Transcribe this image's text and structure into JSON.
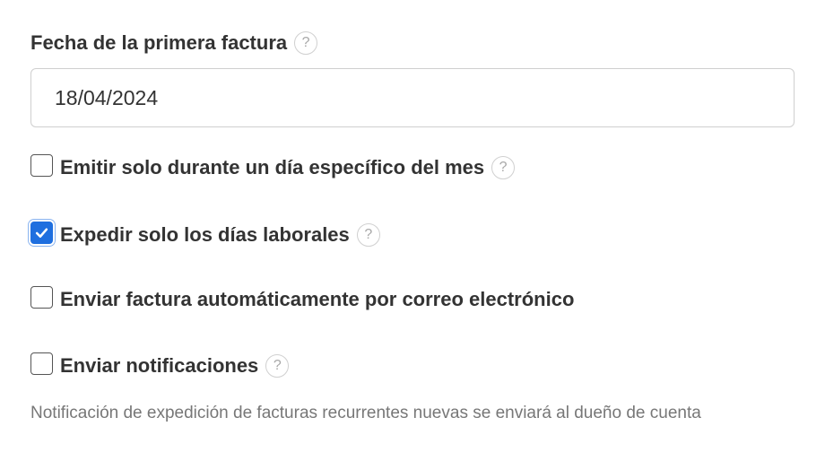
{
  "first_invoice": {
    "label": "Fecha de la primera factura",
    "help_symbol": "?",
    "date_value": "18/04/2024"
  },
  "options": [
    {
      "label": "Emitir solo durante un día específico del mes",
      "checked": false,
      "has_help": true
    },
    {
      "label": "Expedir solo los días laborales",
      "checked": true,
      "has_help": true
    },
    {
      "label": "Enviar factura automáticamente por correo electrónico",
      "checked": false,
      "has_help": false
    },
    {
      "label": "Enviar notificaciones",
      "checked": false,
      "has_help": true
    }
  ],
  "note": "Notificación de expedición de facturas recurrentes nuevas se enviará al dueño de cuenta",
  "colors": {
    "checkbox_checked": "#1f6fdf",
    "text": "#333333",
    "note_text": "#777777"
  }
}
